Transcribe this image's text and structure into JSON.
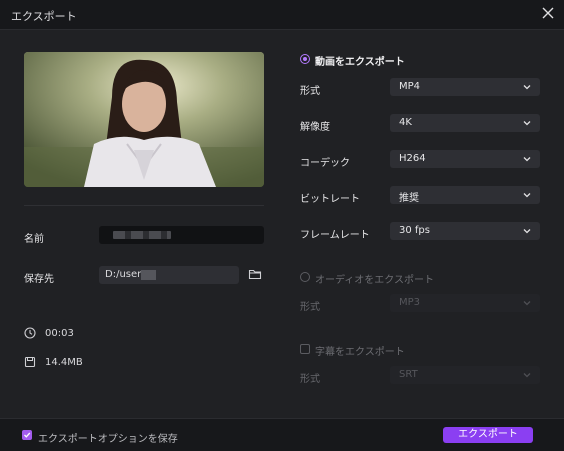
{
  "window": {
    "title": "エクスポート"
  },
  "left": {
    "name_label": "名前",
    "save_to_label": "保存先",
    "path_value": "D:/user/",
    "duration": "00:03",
    "size": "14.4MB"
  },
  "right": {
    "video_export_title": "動画をエクスポート",
    "format_label": "形式",
    "format_value": "MP4",
    "resolution_label": "解像度",
    "resolution_value": "4K",
    "codec_label": "コーデック",
    "codec_value": "H264",
    "bitrate_label": "ビットレート",
    "bitrate_value": "推奨",
    "framerate_label": "フレームレート",
    "framerate_value": "30 fps",
    "audio_export_title": "オーディオをエクスポート",
    "audio_format_label": "形式",
    "audio_format_value": "MP3",
    "subtitle_export_title": "字幕をエクスポート",
    "subtitle_format_label": "形式",
    "subtitle_format_value": "SRT"
  },
  "footer": {
    "save_options_label": "エクスポートオプションを保存",
    "export_button": "エクスポート"
  },
  "colors": {
    "accent": "#8b3ff2",
    "radio_accent": "#b47bff"
  }
}
